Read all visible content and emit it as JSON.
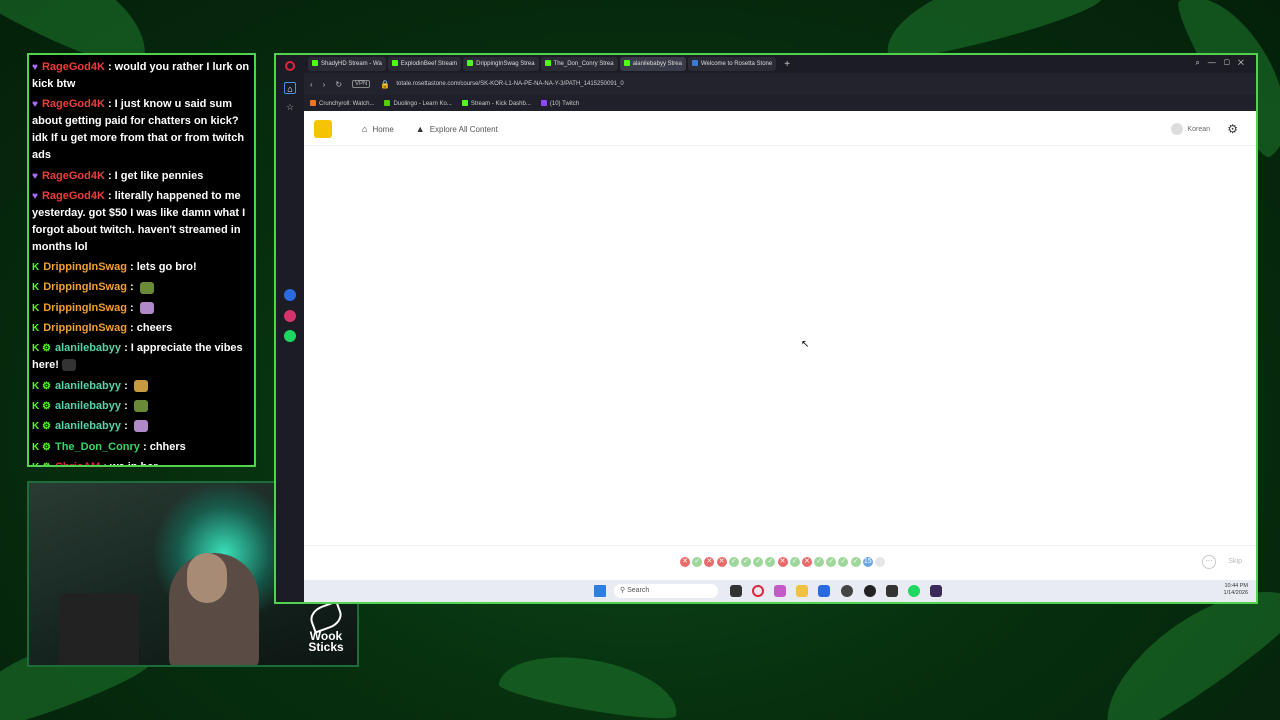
{
  "chat": {
    "messages": [
      {
        "badges": "♥",
        "user": "RageGod4K",
        "color": "#f03c3c",
        "text": "would you rather I lurk on kick btw"
      },
      {
        "badges": "♥",
        "user": "RageGod4K",
        "color": "#f03c3c",
        "text": "I just know u said sum about getting paid for chatters on kick? idk If u get more from that or from twitch ads"
      },
      {
        "badges": "♥",
        "user": "RageGod4K",
        "color": "#f03c3c",
        "text": "I get like pennies"
      },
      {
        "badges": "♥",
        "user": "RageGod4K",
        "color": "#f03c3c",
        "text": "literally happened to me yesterday. got $50 I was like damn what I forgot about twitch. haven't streamed in months lol"
      },
      {
        "badges": "K",
        "user": "DrippingInSwag",
        "color": "#f0a030",
        "text": "lets go bro!"
      },
      {
        "badges": "K",
        "user": "DrippingInSwag",
        "color": "#f0a030",
        "text": ""
      },
      {
        "badges": "K",
        "user": "DrippingInSwag",
        "color": "#f0a030",
        "text": ""
      },
      {
        "badges": "K",
        "user": "DrippingInSwag",
        "color": "#f0a030",
        "text": "cheers"
      },
      {
        "badges": "K ⚙",
        "user": "alanilebabyy",
        "color": "#55d4a8",
        "text": "I appreciate the vibes here!"
      },
      {
        "badges": "K ⚙",
        "user": "alanilebabyy",
        "color": "#55d4a8",
        "text": ""
      },
      {
        "badges": "K ⚙",
        "user": "alanilebabyy",
        "color": "#55d4a8",
        "text": ""
      },
      {
        "badges": "K ⚙",
        "user": "alanilebabyy",
        "color": "#55d4a8",
        "text": ""
      },
      {
        "badges": "K ⚙",
        "user": "The_Don_Conry",
        "color": "#3bd463",
        "text": "chhers"
      },
      {
        "badges": "K ⚙",
        "user": "ChrisAM",
        "color": "#e0243c",
        "text": "we in her"
      }
    ]
  },
  "overlay_logo": {
    "line1": "Wook",
    "line2": "Sticks"
  },
  "browser": {
    "tabs": [
      {
        "label": "ShadyHD Stream - Wa",
        "fav": "#53fc18"
      },
      {
        "label": "ExplodinBeef Stream",
        "fav": "#53fc18"
      },
      {
        "label": "DrippingInSwag Strea",
        "fav": "#53fc18"
      },
      {
        "label": "The_Don_Conry Strea",
        "fav": "#53fc18"
      },
      {
        "label": "alanilebabyy Strea",
        "fav": "#53fc18",
        "active": true
      },
      {
        "label": "Welcome to Rosetta Stone",
        "fav": "#3a7bd5"
      }
    ],
    "url": "totale.rosettastone.com/course/SK-KOR-L1-NA-PE-NA-NA-Y-3/PATH_1415250091_0",
    "bookmarks": [
      {
        "label": "Crunchyroll: Watch...",
        "fav": "#f47521"
      },
      {
        "label": "Duolingo - Learn Ko...",
        "fav": "#58cc02"
      },
      {
        "label": "Stream - Kick Dashb...",
        "fav": "#53fc18"
      },
      {
        "label": "(10) Twitch",
        "fav": "#9146ff"
      }
    ]
  },
  "rosetta": {
    "nav": {
      "home": "Home",
      "explore": "Explore All Content",
      "language": "Korean"
    },
    "progress": {
      "dots": [
        "x",
        "c",
        "x",
        "x",
        "c",
        "c",
        "c",
        "c",
        "x",
        "c",
        "x",
        "c",
        "c",
        "c",
        "c",
        "15",
        "e"
      ],
      "skip": "Skip"
    }
  },
  "taskbar": {
    "search_placeholder": "Search",
    "time": "10:44 PM",
    "date": "1/14/2026"
  }
}
